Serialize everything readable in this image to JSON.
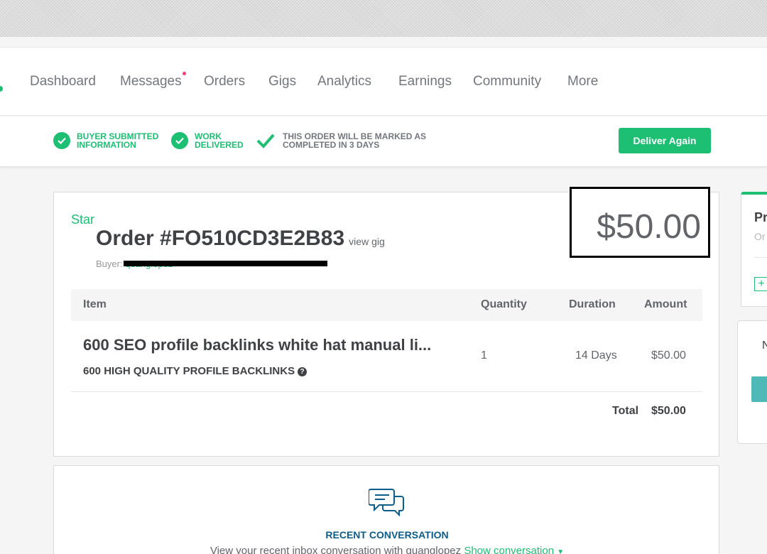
{
  "nav": {
    "items": [
      {
        "label": "Dashboard",
        "notify": false
      },
      {
        "label": "Messages",
        "notify": true
      },
      {
        "label": "Orders",
        "notify": false
      },
      {
        "label": "Gigs",
        "notify": false
      },
      {
        "label": "Analytics",
        "notify": false
      },
      {
        "label": "Earnings",
        "notify": false
      },
      {
        "label": "Community",
        "notify": false
      },
      {
        "label": "More",
        "notify": false
      }
    ]
  },
  "status": {
    "steps": [
      {
        "label": "BUYER SUBMITTED\nINFORMATION",
        "icon": "check-circle-icon"
      },
      {
        "label": "WORK\nDELIVERED",
        "icon": "check-circle-icon"
      },
      {
        "label": "THIS ORDER WILL BE MARKED AS\nCOMPLETED IN 3 DAYS",
        "icon": "check-icon"
      }
    ],
    "deliver_again_label": "Deliver Again"
  },
  "order": {
    "star_label": "Star",
    "title": "Order #FO510CD3E2B83",
    "view_gig": "view gig",
    "buyer_prefix": "Buyer:",
    "buyer_name": "quanglopez",
    "price": "$50.00",
    "table": {
      "headers": {
        "item": "Item",
        "quantity": "Quantity",
        "duration": "Duration",
        "amount": "Amount"
      },
      "rows": [
        {
          "title": "600 SEO profile backlinks white hat manual li...",
          "subtitle": "600 HIGH QUALITY PROFILE BACKLINKS",
          "quantity": "1",
          "duration": "14 Days",
          "amount": "$50.00"
        }
      ],
      "total_label": "Total",
      "total_value": "$50.00"
    }
  },
  "conversation": {
    "title": "RECENT CONVERSATION",
    "text": "View your recent inbox conversation with quanglopez",
    "show_label": "Show conversation"
  },
  "side": {
    "card1_title": "Pr",
    "card1_sub": "Or",
    "card2_text": "N"
  },
  "colors": {
    "brand_green": "#1dbf73",
    "notify_pink": "#ff3b7f",
    "link_blue": "#0b5d8c"
  }
}
